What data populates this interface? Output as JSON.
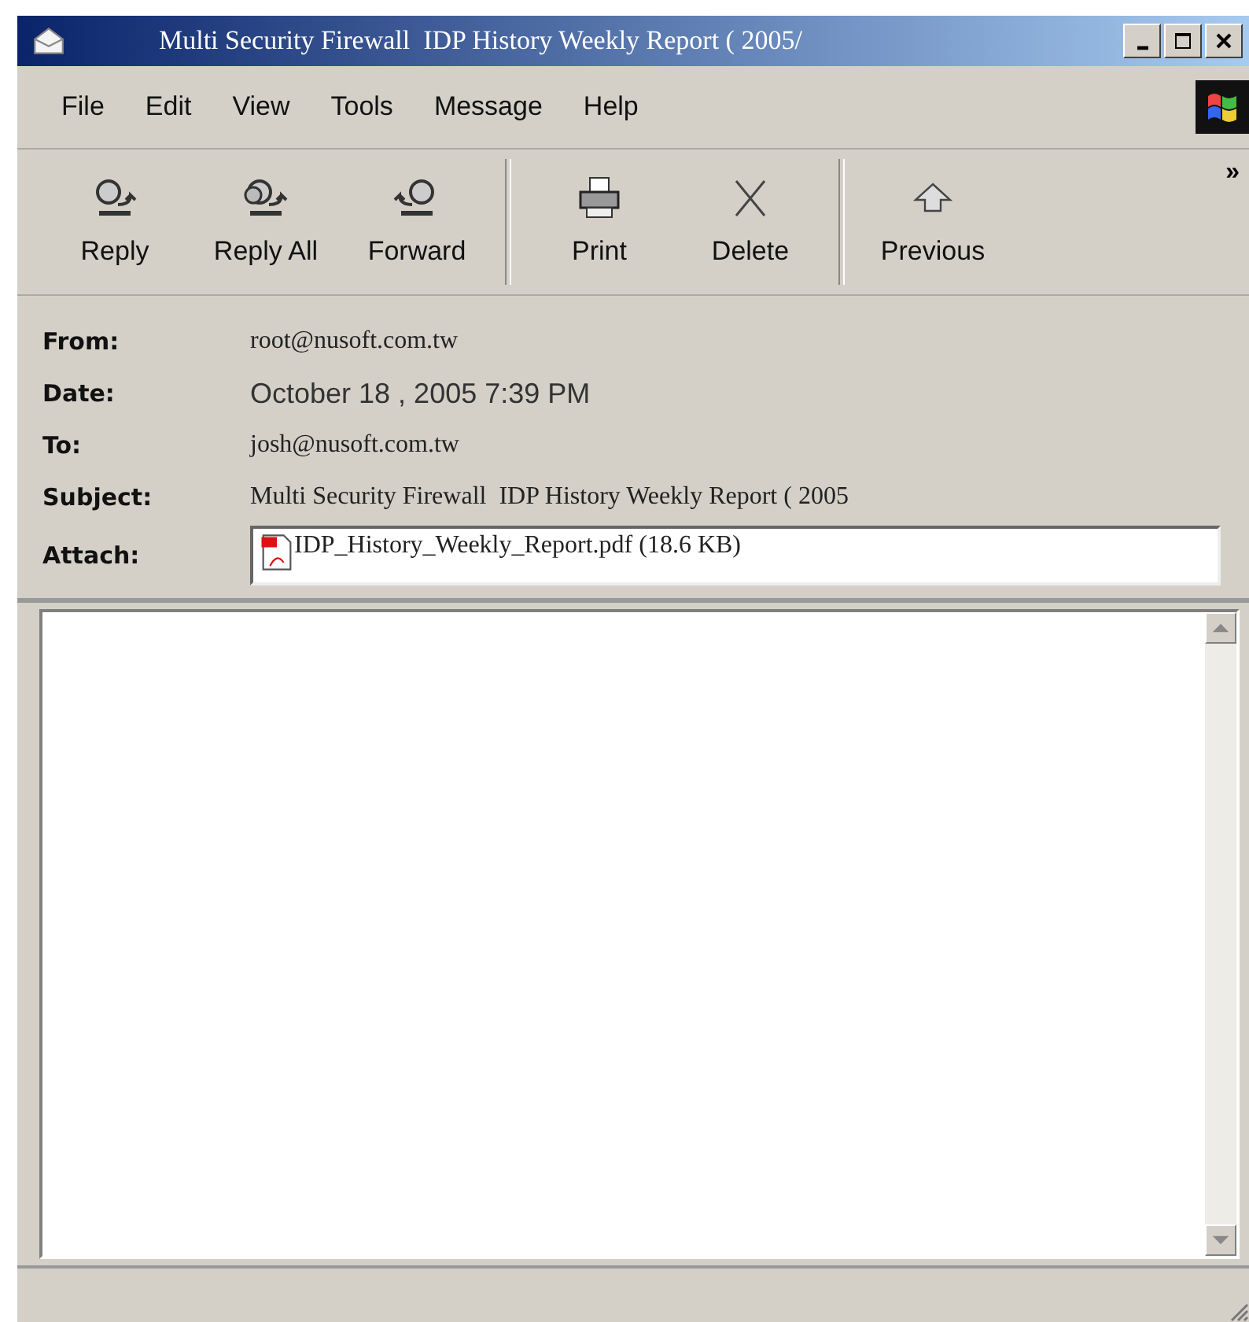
{
  "window": {
    "title": "Multi Security Firewall  IDP History Weekly Report ( 2005/"
  },
  "menu": [
    "File",
    "Edit",
    "View",
    "Tools",
    "Message",
    "Help"
  ],
  "toolbar": {
    "groups": [
      [
        {
          "label": "Reply",
          "kind": "reply"
        },
        {
          "label": "Reply All",
          "kind": "reply_all"
        },
        {
          "label": "Forward",
          "kind": "forward"
        }
      ],
      [
        {
          "label": "Print",
          "kind": "print"
        },
        {
          "label": "Delete",
          "kind": "delete"
        }
      ],
      [
        {
          "label": "Previous",
          "kind": "previous"
        }
      ]
    ],
    "overflow": "»"
  },
  "headers": [
    {
      "label": "From:",
      "value": "root@nusoft.com.tw",
      "kind": "text"
    },
    {
      "label": "Date:",
      "value": "October 18 , 2005 7:39 PM",
      "kind": "date"
    },
    {
      "label": "To:",
      "value": "josh@nusoft.com.tw",
      "kind": "text"
    },
    {
      "label": "Subject:",
      "value": "Multi Security Firewall  IDP History Weekly Report ( 2005",
      "kind": "text"
    },
    {
      "label": "Attach:",
      "value": "IDP_History_Weekly_Report.pdf (18.6 KB)",
      "kind": "attachment"
    }
  ]
}
